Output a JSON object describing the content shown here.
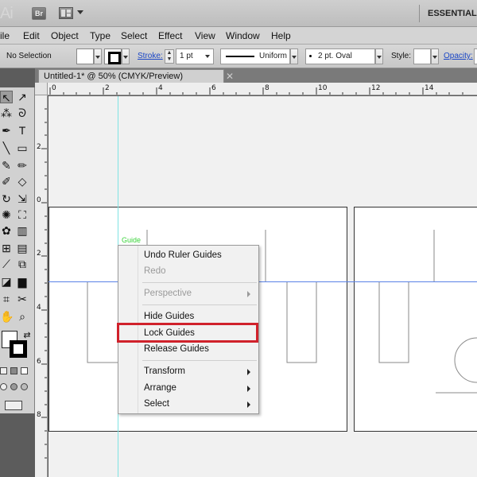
{
  "app": {
    "logo_text": "Ai",
    "bridge_label": "Br",
    "workspace_label": "ESSENTIALS"
  },
  "menubar": {
    "items": [
      "ile",
      "Edit",
      "Object",
      "Type",
      "Select",
      "Effect",
      "View",
      "Window",
      "Help"
    ]
  },
  "control_bar": {
    "selection_label": "No Selection",
    "stroke_label": "Stroke:",
    "stroke_weight": "1 pt",
    "profile": "Uniform",
    "brush": "2 pt. Oval",
    "style_label": "Style:",
    "opacity_label": "Opacity:"
  },
  "document": {
    "tab_title": "Untitled-1* @ 50% (CMYK/Preview)",
    "close_glyph": "✕"
  },
  "rulers": {
    "horizontal": [
      "0",
      "2",
      "4",
      "6",
      "8",
      "10",
      "12",
      "14"
    ],
    "vertical": [
      "2",
      "0",
      "2",
      "4",
      "6",
      "8"
    ]
  },
  "canvas": {
    "guide_label": "Guide"
  },
  "context_menu": {
    "items": [
      {
        "label": "Undo Ruler Guides",
        "enabled": true,
        "submenu": false
      },
      {
        "label": "Redo",
        "enabled": false,
        "submenu": false
      },
      {
        "label": "Perspective",
        "enabled": false,
        "submenu": true
      },
      {
        "label": "Hide Guides",
        "enabled": true,
        "submenu": false
      },
      {
        "label": "Lock Guides",
        "enabled": true,
        "submenu": false,
        "highlighted": true
      },
      {
        "label": "Release Guides",
        "enabled": true,
        "submenu": false
      },
      {
        "label": "Transform",
        "enabled": true,
        "submenu": true
      },
      {
        "label": "Arrange",
        "enabled": true,
        "submenu": true
      },
      {
        "label": "Select",
        "enabled": true,
        "submenu": true
      }
    ]
  },
  "colors": {
    "highlight_border": "#d0212b",
    "vertical_guide": "#7fe3e3",
    "horizontal_guide": "#5a82e6",
    "guide_label": "#39d339",
    "link_blue": "#1b47c7"
  },
  "icons": {
    "tools": [
      "selection-tool-icon",
      "direct-selection-tool-icon",
      "magic-wand-icon",
      "lasso-icon",
      "pen-tool-icon",
      "type-tool-icon",
      "line-segment-icon",
      "rectangle-tool-icon",
      "paintbrush-icon",
      "pencil-icon",
      "blob-brush-icon",
      "eraser-icon",
      "rotate-icon",
      "scale-icon",
      "warp-icon",
      "free-transform-icon",
      "symbol-sprayer-icon",
      "column-graph-icon",
      "mesh-icon",
      "gradient-icon",
      "eyedropper-icon",
      "blend-icon",
      "live-paint-icon",
      "slice-icon",
      "hand-icon",
      "zoom-icon"
    ]
  }
}
